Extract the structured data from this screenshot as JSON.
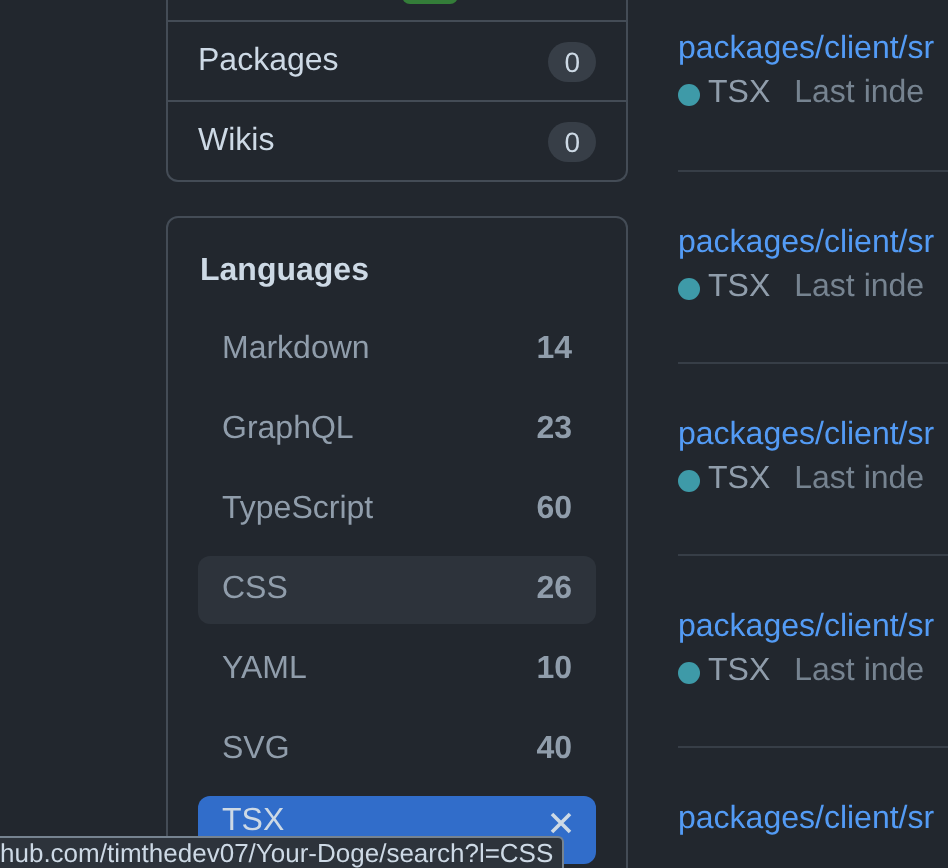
{
  "filters": [
    {
      "label": "Packages",
      "count": "0"
    },
    {
      "label": "Wikis",
      "count": "0"
    }
  ],
  "languages": {
    "title": "Languages",
    "items": [
      {
        "name": "Markdown",
        "count": "14",
        "selected": false,
        "hovered": false
      },
      {
        "name": "GraphQL",
        "count": "23",
        "selected": false,
        "hovered": false
      },
      {
        "name": "TypeScript",
        "count": "60",
        "selected": false,
        "hovered": false
      },
      {
        "name": "CSS",
        "count": "26",
        "selected": false,
        "hovered": true
      },
      {
        "name": "YAML",
        "count": "10",
        "selected": false,
        "hovered": false
      },
      {
        "name": "SVG",
        "count": "40",
        "selected": false,
        "hovered": false
      },
      {
        "name": "TSX",
        "selected": true,
        "hovered": false
      }
    ]
  },
  "results": [
    {
      "path": "packages/client/sr",
      "language": "TSX",
      "color": "#3e9aa8",
      "meta": "Last inde"
    },
    {
      "path": "packages/client/sr",
      "language": "TSX",
      "color": "#3e9aa8",
      "meta": "Last inde"
    },
    {
      "path": "packages/client/sr",
      "language": "TSX",
      "color": "#3e9aa8",
      "meta": "Last inde"
    },
    {
      "path": "packages/client/sr",
      "language": "TSX",
      "color": "#3e9aa8",
      "meta": "Last inde"
    },
    {
      "path": "packages/client/sr"
    }
  ],
  "status_bar": {
    "url": "hub.com/timthedev07/Your-Doge/search?l=CSS"
  }
}
